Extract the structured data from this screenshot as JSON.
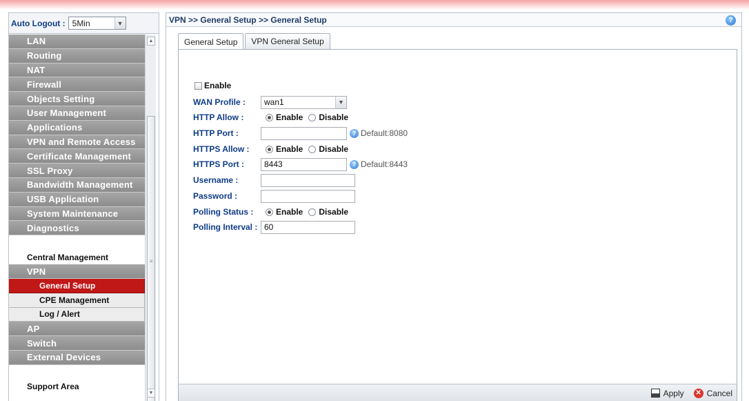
{
  "sidebar": {
    "auto_logout_label": "Auto Logout :",
    "auto_logout_value": "5Min",
    "menu_top": [
      "LAN",
      "Routing",
      "NAT",
      "Firewall",
      "Objects Setting",
      "User Management",
      "Applications",
      "VPN and Remote Access",
      "Certificate Management",
      "SSL Proxy",
      "Bandwidth Management",
      "USB Application",
      "System Maintenance",
      "Diagnostics"
    ],
    "central_management": "Central Management",
    "vpn": "VPN",
    "vpn_sub": [
      "General Setup",
      "CPE Management",
      "Log / Alert"
    ],
    "active_sub": "General Setup",
    "menu_bottom": [
      "AP",
      "Switch",
      "External Devices"
    ],
    "support_area": "Support Area"
  },
  "breadcrumb": "VPN >> General Setup >> General Setup",
  "tabs": [
    "General Setup",
    "VPN General Setup"
  ],
  "form": {
    "enable_label": "Enable",
    "wan_profile_label": "WAN Profile :",
    "wan_profile_value": "wan1",
    "http_allow_label": "HTTP Allow :",
    "https_allow_label": "HTTPS Allow :",
    "polling_status_label": "Polling Status :",
    "radio_enable": "Enable",
    "radio_disable": "Disable",
    "http_port_label": "HTTP Port :",
    "http_port_value": "",
    "http_port_default": "Default:8080",
    "https_port_label": "HTTPS Port :",
    "https_port_value": "8443",
    "https_port_default": "Default:8443",
    "username_label": "Username :",
    "password_label": "Password :",
    "polling_interval_label": "Polling Interval :",
    "polling_interval_value": "60"
  },
  "footer": {
    "apply": "Apply",
    "cancel": "Cancel"
  },
  "colors": {
    "active_menu": "#c01717",
    "menu_gray": "#999999",
    "label_blue": "#0f3c88"
  }
}
